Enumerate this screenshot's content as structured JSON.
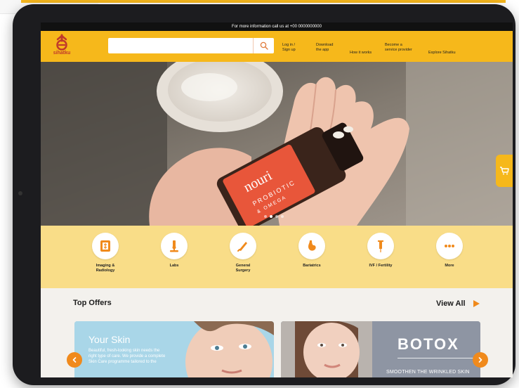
{
  "announcement": "For more information call us at +00 0000000000",
  "brand": {
    "name": "sihatku",
    "accent": "#f6b81b",
    "logo_red": "#c0392b",
    "button_orange": "#f08a1c",
    "category_strip": "#f9dd88"
  },
  "search": {
    "value": "",
    "placeholder": "",
    "icon": "search-icon"
  },
  "nav": {
    "login": "Log in /",
    "signup": "Sign up",
    "download_1": "Download",
    "download_2": "the app",
    "how_it_works": "How it works",
    "provider_1": "Become a",
    "provider_2": "service provider",
    "explore": "Explore Sihatku"
  },
  "hero": {
    "bottle_brand": "nouri",
    "bottle_line_1": "PROBIOTIC",
    "bottle_line_2": "& OMEGA",
    "slides": 4,
    "active_slide": 1,
    "cart_icon": "cart-icon"
  },
  "categories": [
    {
      "label_1": "Imaging &",
      "label_2": "Radiology",
      "icon": "imaging-icon"
    },
    {
      "label_1": "Labs",
      "label_2": "",
      "icon": "microscope-icon"
    },
    {
      "label_1": "General",
      "label_2": "Surgery",
      "icon": "scalpel-icon"
    },
    {
      "label_1": "Bariatrics",
      "label_2": "",
      "icon": "stomach-icon"
    },
    {
      "label_1": "IVF / Fertility",
      "label_2": "",
      "icon": "syringe-icon"
    },
    {
      "label_1": "More",
      "label_2": "",
      "icon": "more-icon"
    }
  ],
  "offers": {
    "title": "Top Offers",
    "view_all": "View All",
    "cards": [
      {
        "title": "Your Skin",
        "body_1": "Beautiful, fresh-looking skin needs the",
        "body_2": "right type of care. We provide a complete",
        "body_3": "Skin Care programme tailored to the"
      },
      {
        "title": "BOTOX",
        "subtitle": "SMOOTHEN THE WRINKLED SKIN"
      }
    ]
  }
}
